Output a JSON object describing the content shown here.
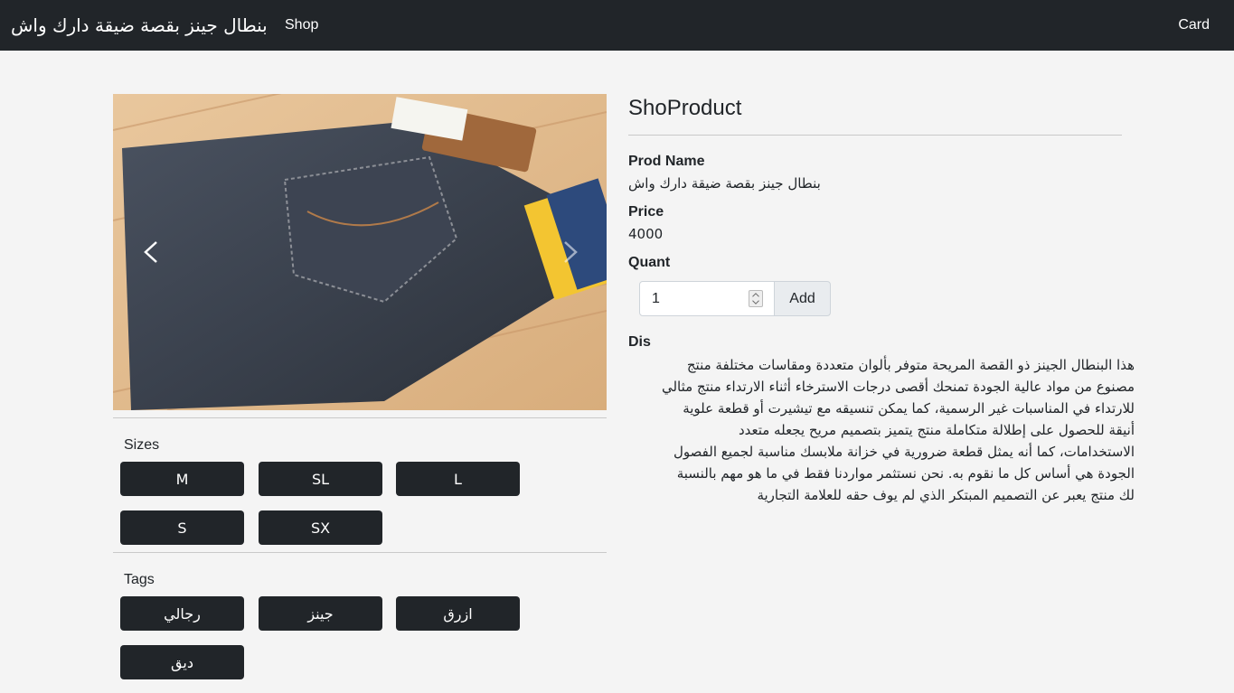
{
  "navbar": {
    "brand": "بنطال جينز بقصة ضيقة دارك واش",
    "shop": "Shop",
    "card": "Card"
  },
  "gallery": {
    "prev_icon": "chevron-left-icon",
    "next_icon": "chevron-right-icon"
  },
  "sizes": {
    "label": "Sizes",
    "items": [
      "M",
      "SL",
      "L",
      "S",
      "SX"
    ]
  },
  "tags": {
    "label": "Tags",
    "items": [
      "رجالي",
      "جينز",
      "ازرق",
      "ديق"
    ]
  },
  "product": {
    "title": "ShoProduct",
    "name_label": "Prod Name",
    "name_value": "بنطال جينز بقصة ضيقة دارك واش",
    "price_label": "Price",
    "price_value": "4000",
    "quant_label": "Quant",
    "quant_value": "1",
    "add_label": "Add",
    "dis_label": "Dis",
    "description_lines": [
      "هذا البنطال الجينز ذو القصة المريحة متوفر بألوان متعددة ومقاسات مختلفة منتج",
      "مصنوع من مواد عالية الجودة تمنحك أقصى درجات الاسترخاء أثناء الارتداء منتج مثالي",
      "للارتداء في المناسبات غير الرسمية، كما يمكن تنسيقه مع تيشيرت أو قطعة علوية",
      "أنيقة للحصول على إطلالة متكاملة منتج يتميز بتصميم مريح يجعله متعدد",
      "الاستخدامات، كما أنه يمثل قطعة ضرورية في خزانة ملابسك مناسبة لجميع الفصول",
      "الجودة هي أساس كل ما نقوم به. نحن نستثمر مواردنا فقط في ما هو مهم بالنسبة",
      "لك منتج يعبر عن التصميم المبتكر الذي لم يوف حقه للعلامة التجارية"
    ]
  }
}
